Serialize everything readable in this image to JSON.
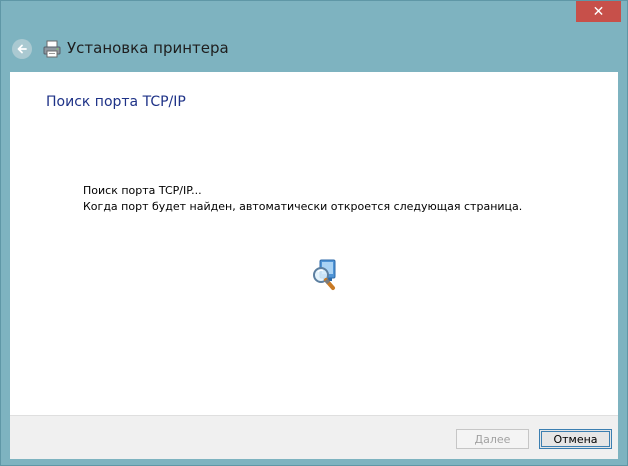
{
  "window": {
    "title": "Установка принтера",
    "close_glyph": "✕",
    "frame_color": "#7eb3c0",
    "close_button_color": "#c7504a"
  },
  "icons": {
    "back": "back-arrow-icon",
    "printer": "printer-icon",
    "search": "search-port-icon"
  },
  "page": {
    "heading": "Поиск порта TCP/IP",
    "heading_color": "#1e3287",
    "message_line1": "Поиск порта TCP/IP...",
    "message_line2": "Когда порт будет найден, автоматически откроется следующая страница."
  },
  "footer": {
    "next_label": "Далее",
    "next_enabled": false,
    "cancel_label": "Отмена"
  }
}
